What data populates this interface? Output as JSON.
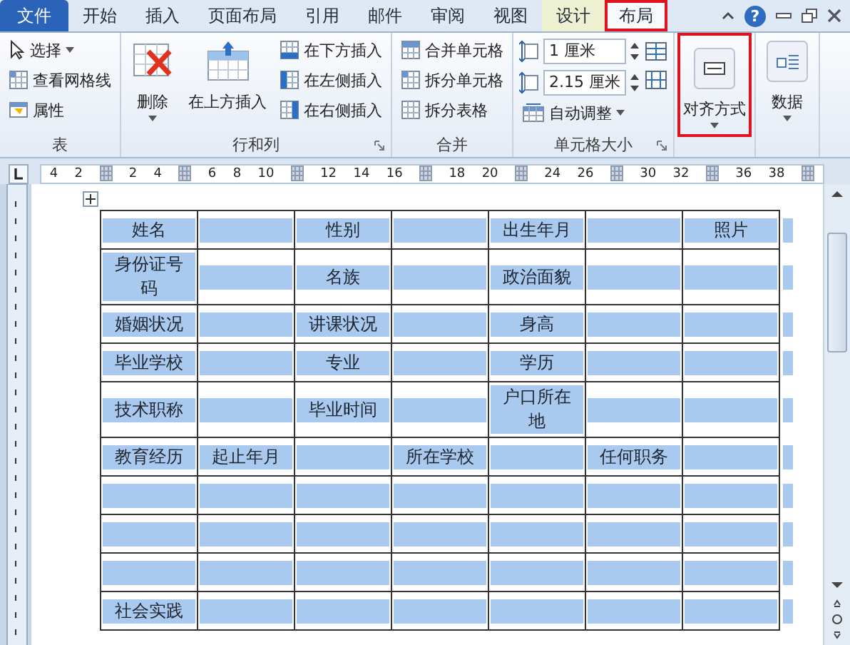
{
  "tabs": [
    {
      "label": "文件",
      "kind": "file",
      "selected": false,
      "contextual": false,
      "annotated": false
    },
    {
      "label": "开始",
      "kind": "tab",
      "selected": false,
      "contextual": false,
      "annotated": false
    },
    {
      "label": "插入",
      "kind": "tab",
      "selected": false,
      "contextual": false,
      "annotated": false
    },
    {
      "label": "页面布局",
      "kind": "tab",
      "selected": false,
      "contextual": false,
      "annotated": false
    },
    {
      "label": "引用",
      "kind": "tab",
      "selected": false,
      "contextual": false,
      "annotated": false
    },
    {
      "label": "邮件",
      "kind": "tab",
      "selected": false,
      "contextual": false,
      "annotated": false
    },
    {
      "label": "审阅",
      "kind": "tab",
      "selected": false,
      "contextual": false,
      "annotated": false
    },
    {
      "label": "视图",
      "kind": "tab",
      "selected": false,
      "contextual": false,
      "annotated": false
    },
    {
      "label": "设计",
      "kind": "tab",
      "selected": false,
      "contextual": true,
      "annotated": false
    },
    {
      "label": "布局",
      "kind": "tab",
      "selected": true,
      "contextual": true,
      "annotated": true
    }
  ],
  "help_label": "?",
  "ribbon": {
    "groups": [
      {
        "label": "表",
        "launcher": false,
        "columns": [
          [
            {
              "kind": "small",
              "label": "选择",
              "dropdown": true
            },
            {
              "kind": "small",
              "label": "查看网格线",
              "dropdown": false
            },
            {
              "kind": "small",
              "label": "属性",
              "dropdown": false
            }
          ]
        ]
      },
      {
        "label": "行和列",
        "launcher": true,
        "columns": [
          [
            {
              "kind": "large",
              "label": "删除",
              "dropdown": true,
              "annotated": false
            }
          ],
          [
            {
              "kind": "large",
              "label": "在上方插入",
              "dropdown": false,
              "annotated": false
            }
          ],
          [
            {
              "kind": "small",
              "label": "在下方插入",
              "dropdown": false
            },
            {
              "kind": "small",
              "label": "在左侧插入",
              "dropdown": false
            },
            {
              "kind": "small",
              "label": "在右侧插入",
              "dropdown": false
            }
          ]
        ]
      },
      {
        "label": "合并",
        "launcher": false,
        "columns": [
          [
            {
              "kind": "small",
              "label": "合并单元格",
              "dropdown": false
            },
            {
              "kind": "small",
              "label": "拆分单元格",
              "dropdown": false
            },
            {
              "kind": "small",
              "label": "拆分表格",
              "dropdown": false
            }
          ]
        ]
      },
      {
        "label": "单元格大小",
        "launcher": true,
        "columns": [
          [
            {
              "kind": "spin",
              "value": "1 厘米"
            },
            {
              "kind": "spin",
              "value": "2.15 厘米"
            },
            {
              "kind": "small",
              "label": "自动调整",
              "dropdown": true
            }
          ],
          [
            {
              "kind": "icon"
            },
            {
              "kind": "icon"
            }
          ]
        ]
      },
      {
        "launcher": false,
        "columns": [
          [
            {
              "kind": "large",
              "label": "对齐方式",
              "dropdown": true,
              "annotated": true
            }
          ]
        ]
      },
      {
        "launcher": false,
        "columns": [
          [
            {
              "kind": "large",
              "label": "数据",
              "dropdown": true,
              "annotated": false
            }
          ]
        ]
      }
    ]
  },
  "ruler": [
    {
      "kind": "num",
      "text": "4"
    },
    {
      "kind": "num",
      "text": "2"
    },
    {
      "kind": "marker"
    },
    {
      "kind": "num",
      "text": "2"
    },
    {
      "kind": "num",
      "text": "4"
    },
    {
      "kind": "marker"
    },
    {
      "kind": "num",
      "text": "6"
    },
    {
      "kind": "num",
      "text": "8"
    },
    {
      "kind": "num",
      "text": "10"
    },
    {
      "kind": "marker"
    },
    {
      "kind": "num",
      "text": "12"
    },
    {
      "kind": "num",
      "text": "14"
    },
    {
      "kind": "num",
      "text": "16"
    },
    {
      "kind": "marker"
    },
    {
      "kind": "num",
      "text": "18"
    },
    {
      "kind": "num",
      "text": "20"
    },
    {
      "kind": "marker"
    },
    {
      "kind": "num",
      "text": "24"
    },
    {
      "kind": "num",
      "text": "26"
    },
    {
      "kind": "marker"
    },
    {
      "kind": "num",
      "text": "30"
    },
    {
      "kind": "num",
      "text": "32"
    },
    {
      "kind": "marker"
    },
    {
      "kind": "num",
      "text": "36"
    },
    {
      "kind": "num",
      "text": "38"
    },
    {
      "kind": "marker"
    }
  ],
  "table": {
    "selected": true,
    "rows": [
      [
        "姓名",
        null,
        "性别",
        null,
        "出生年月",
        null,
        "照片"
      ],
      [
        "身份证号码",
        null,
        "名族",
        null,
        "政治面貌",
        null,
        null
      ],
      [
        "婚姻状况",
        null,
        "讲课状况",
        null,
        "身高",
        null,
        null
      ],
      [
        "毕业学校",
        null,
        "专业",
        null,
        "学历",
        null,
        null
      ],
      [
        "技术职称",
        null,
        "毕业时间",
        null,
        "户口所在地",
        null,
        null
      ],
      [
        "教育经历",
        "起止年月",
        null,
        "所在学校",
        null,
        "任何职务",
        null
      ],
      [
        null,
        null,
        null,
        null,
        null,
        null,
        null
      ],
      [
        null,
        null,
        null,
        null,
        null,
        null,
        null
      ],
      [
        null,
        null,
        null,
        null,
        null,
        null,
        null
      ],
      [
        "社会实践",
        null,
        null,
        null,
        null,
        null,
        null
      ]
    ]
  }
}
